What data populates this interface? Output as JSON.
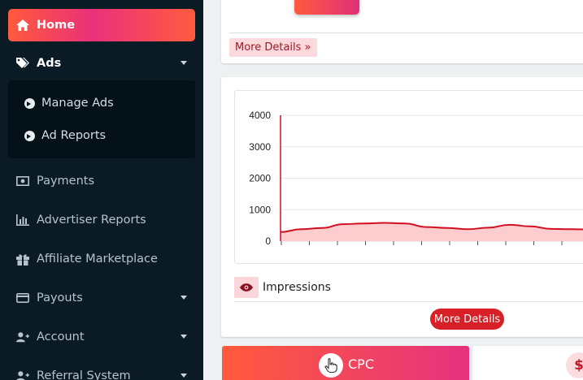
{
  "sidebar": {
    "home": "Home",
    "ads": "Ads",
    "submenu": [
      "Manage Ads",
      "Ad Reports"
    ],
    "payments": "Payments",
    "advertiser_reports": "Advertiser Reports",
    "affiliate_marketplace": "Affiliate Marketplace",
    "payouts": "Payouts",
    "account": "Account",
    "referral_system": "Referral System"
  },
  "card_top": {
    "more_details": "More Details »"
  },
  "impressions_card": {
    "legend_label": "Impressions",
    "more_details": "More Details"
  },
  "chart_data": {
    "type": "area",
    "ylim": [
      0,
      4000
    ],
    "yticks": [
      "4000",
      "3000",
      "2000",
      "1000",
      "0"
    ],
    "series": [
      {
        "name": "Impressions",
        "values": [
          290,
          380,
          420,
          540,
          560,
          580,
          560,
          450,
          420,
          380,
          430,
          520,
          470,
          390,
          380,
          370
        ]
      }
    ],
    "color": "#d0101f",
    "fill": "#fbc3c5"
  },
  "cpc_card": {
    "label": "CPC"
  },
  "colors": {
    "accent_start": "#ff5a3c",
    "accent_end": "#e5327e",
    "sidebar_bg": "#0a1b26",
    "red": "#d71f27"
  }
}
